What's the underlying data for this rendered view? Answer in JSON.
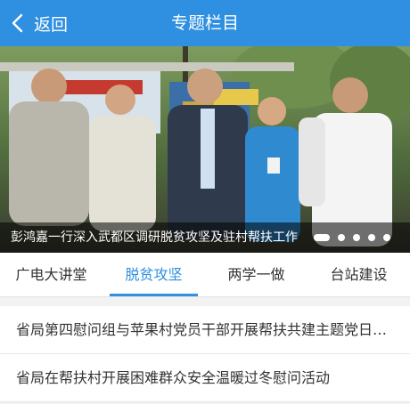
{
  "header": {
    "back_label": "返回",
    "title": "专题栏目"
  },
  "banner": {
    "caption": "彭鸿嘉一行深入武都区调研脱贫攻坚及驻村帮扶工作",
    "slide_count": 5,
    "active_slide": 1
  },
  "tabs": [
    {
      "label": "广电大讲堂",
      "active": false
    },
    {
      "label": "脱贫攻坚",
      "active": true
    },
    {
      "label": "两学一做",
      "active": false
    },
    {
      "label": "台站建设",
      "active": false
    }
  ],
  "list": [
    {
      "title": "省局第四慰问组与苹果村党员干部开展帮扶共建主题党日活动"
    },
    {
      "title": "省局在帮扶村开展困难群众安全温暖过冬慰问活动"
    }
  ],
  "colors": {
    "accent": "#2f8fe0",
    "text": "#333333",
    "background": "#f2f2f2"
  }
}
